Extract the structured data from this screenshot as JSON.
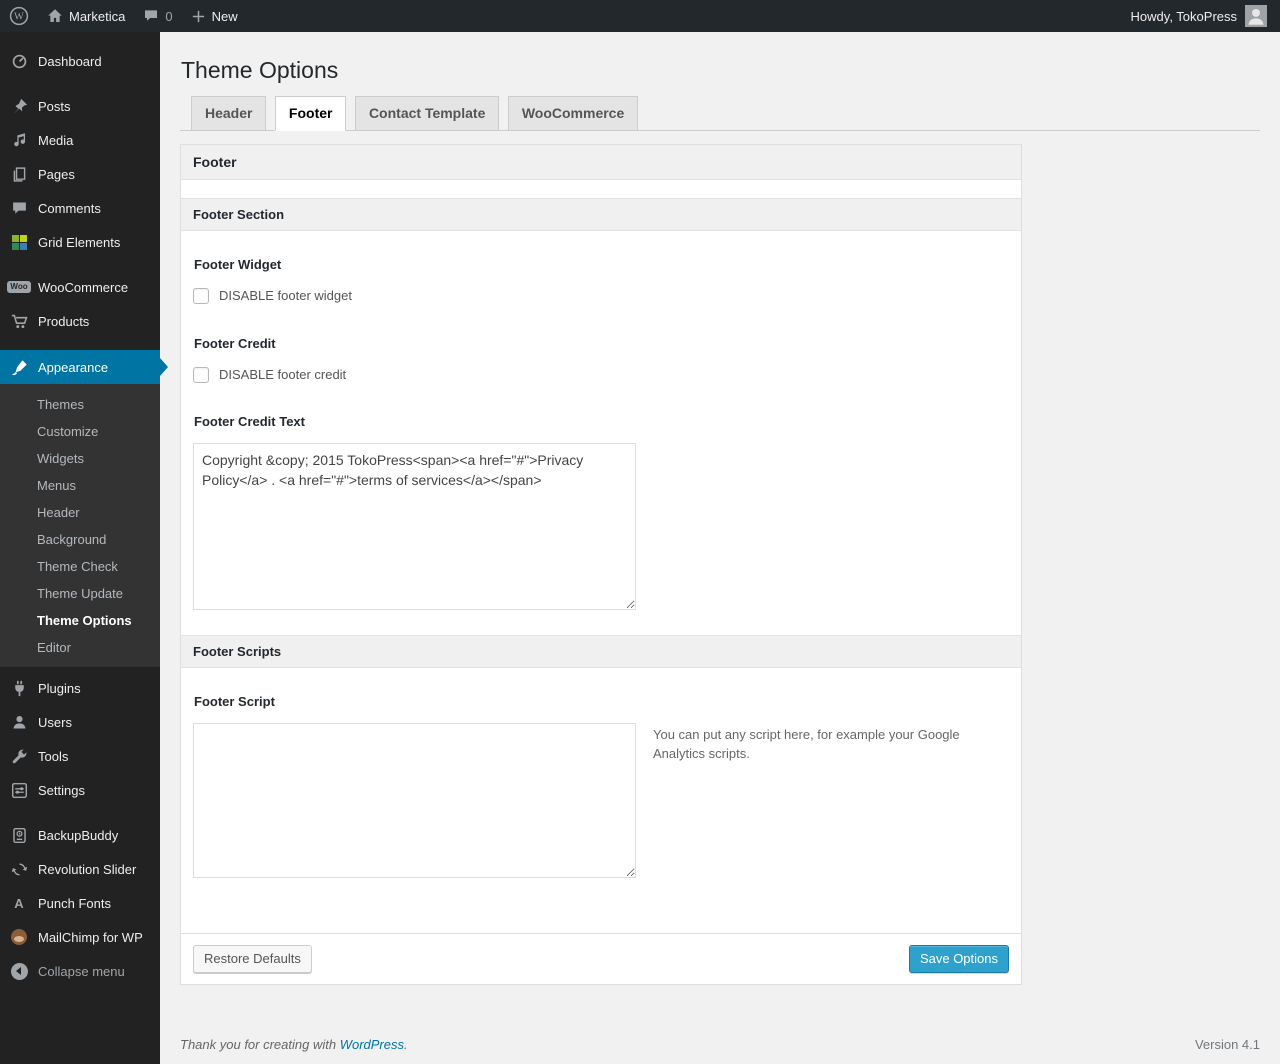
{
  "admin_bar": {
    "site_name": "Marketica",
    "comment_count": "0",
    "new_label": "New",
    "howdy": "Howdy, TokoPress",
    "wp_logo_letter": "W"
  },
  "sidebar": {
    "items": [
      {
        "label": "Dashboard",
        "icon": "dashboard-icon"
      },
      {
        "label": "Posts",
        "icon": "pushpin-icon"
      },
      {
        "label": "Media",
        "icon": "music-note-icon"
      },
      {
        "label": "Pages",
        "icon": "pages-icon"
      },
      {
        "label": "Comments",
        "icon": "comment-bubble-icon"
      },
      {
        "label": "Grid Elements",
        "icon": "grid-elements-icon"
      },
      {
        "label": "WooCommerce",
        "icon": "woo-badge-icon",
        "badge_text": "Woo"
      },
      {
        "label": "Products",
        "icon": "cart-icon"
      },
      {
        "label": "Appearance",
        "icon": "brush-icon",
        "active": true
      },
      {
        "label": "Plugins",
        "icon": "plug-icon"
      },
      {
        "label": "Users",
        "icon": "person-icon"
      },
      {
        "label": "Tools",
        "icon": "wrench-icon"
      },
      {
        "label": "Settings",
        "icon": "sliders-icon"
      },
      {
        "label": "BackupBuddy",
        "icon": "backup-box-icon"
      },
      {
        "label": "Revolution Slider",
        "icon": "rotate-arrows-icon"
      },
      {
        "label": "Punch Fonts",
        "icon": "letter-a-icon",
        "glyph": "A"
      },
      {
        "label": "MailChimp for WP",
        "icon": "monkey-icon"
      },
      {
        "label": "Collapse menu",
        "icon": "collapse-arrow-icon"
      }
    ],
    "appearance_submenu": [
      {
        "label": "Themes"
      },
      {
        "label": "Customize"
      },
      {
        "label": "Widgets"
      },
      {
        "label": "Menus"
      },
      {
        "label": "Header"
      },
      {
        "label": "Background"
      },
      {
        "label": "Theme Check"
      },
      {
        "label": "Theme Update"
      },
      {
        "label": "Theme Options",
        "active": true
      },
      {
        "label": "Editor"
      }
    ]
  },
  "page": {
    "title": "Theme Options",
    "tabs": [
      {
        "label": "Header",
        "active": false
      },
      {
        "label": "Footer",
        "active": true
      },
      {
        "label": "Contact Template",
        "active": false
      },
      {
        "label": "WooCommerce",
        "active": false
      }
    ]
  },
  "panel": {
    "header_title": "Footer",
    "footer_section_title": "Footer Section",
    "footer_widget_label": "Footer Widget",
    "footer_widget_checkbox_label": "DISABLE footer widget",
    "footer_widget_checked": false,
    "footer_credit_label": "Footer Credit",
    "footer_credit_checkbox_label": "DISABLE footer credit",
    "footer_credit_checked": false,
    "footer_credit_text_label": "Footer Credit Text",
    "footer_credit_text_value": "Copyright &copy; 2015 TokoPress<span><a href=\"#\">Privacy Policy</a> . <a href=\"#\">terms of services</a></span>",
    "footer_scripts_title": "Footer Scripts",
    "footer_script_label": "Footer Script",
    "footer_script_value": "",
    "footer_script_help": "You can put any script here, for example your Google Analytics scripts.",
    "restore_button_label": "Restore Defaults",
    "save_button_label": "Save Options"
  },
  "footer": {
    "thanks_prefix": "Thank you for creating with",
    "wordpress_link": "WordPress",
    "thanks_suffix": ".",
    "version": "Version 4.1"
  },
  "colors": {
    "accent_blue": "#0074a2",
    "primary_button": "#2ea2cc",
    "admin_bar_bg": "#23282d",
    "menu_bg": "#222222",
    "submenu_bg": "#333333",
    "page_bg": "#f1f1f1"
  }
}
